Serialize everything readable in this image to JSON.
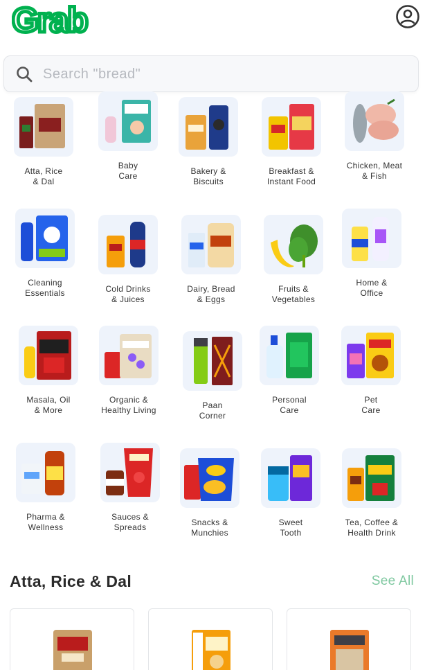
{
  "header": {
    "logo": "Grab",
    "account_icon": "account-circle-icon"
  },
  "search": {
    "placeholder": "Search \"bread\"",
    "value": "",
    "icon": "search-icon"
  },
  "categories": [
    {
      "label": "Atta, Rice\n& Dal"
    },
    {
      "label": "Baby\nCare"
    },
    {
      "label": "Bakery &\nBiscuits"
    },
    {
      "label": "Breakfast &\nInstant Food"
    },
    {
      "label": "Chicken, Meat\n& Fish"
    },
    {
      "label": "Cleaning\nEssentials"
    },
    {
      "label": "Cold Drinks\n& Juices"
    },
    {
      "label": "Dairy, Bread\n& Eggs"
    },
    {
      "label": "Fruits &\nVegetables"
    },
    {
      "label": "Home &\nOffice"
    },
    {
      "label": "Masala, Oil\n& More"
    },
    {
      "label": "Organic &\nHealthy Living"
    },
    {
      "label": "Paan\nCorner"
    },
    {
      "label": "Personal\nCare"
    },
    {
      "label": "Pet\nCare"
    },
    {
      "label": "Pharma &\nWellness"
    },
    {
      "label": "Sauces &\nSpreads"
    },
    {
      "label": "Snacks &\nMunchies"
    },
    {
      "label": "Sweet\nTooth"
    },
    {
      "label": "Tea, Coffee &\nHealth Drink"
    }
  ],
  "section": {
    "title": "Atta, Rice & Dal",
    "see_all": "See All"
  },
  "colors": {
    "brand_green": "#00b14f",
    "see_all_green": "#7fc8a0",
    "thumb_bg": "#eef3fb"
  }
}
